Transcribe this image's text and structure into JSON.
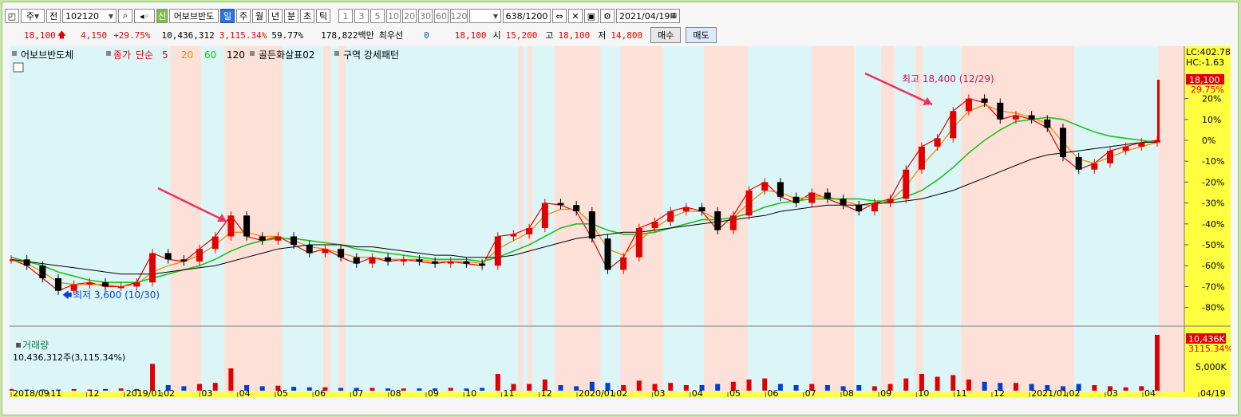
{
  "toolbar": {
    "market": "주",
    "period_short": "전",
    "stock_code": "102120",
    "badge_new": "신",
    "stock_name": "어보브반도",
    "period_tabs": [
      "일",
      "주",
      "월",
      "년",
      "분",
      "초",
      "틱"
    ],
    "active_period": "일",
    "minute_intervals": [
      "1",
      "3",
      "5",
      "10",
      "20",
      "30",
      "60",
      "120"
    ],
    "count_display": "638/1200",
    "date": "2021/04/19"
  },
  "quote": {
    "price": "18,100",
    "change": "4,150",
    "change_pct": "+29.75%",
    "volume": "10,436,312",
    "volume_ratio": "3,115.34%",
    "turnover": "59.77%",
    "value": "178,822백만",
    "priority_label": "최우선",
    "priority_bid": "0",
    "priority_ask": "18,100",
    "open_label": "시",
    "open": "15,200",
    "high_label": "고",
    "high": "18,100",
    "low_label": "저",
    "low": "14,800",
    "buy_label": "매수",
    "sell_label": "매도"
  },
  "legend": {
    "name": "어보브반도체",
    "close": "종가",
    "ma_type": "단순",
    "ma5": "5",
    "ma20": "20",
    "ma60": "60",
    "ma120": "120",
    "golden": "골든화살표02",
    "zone": "구역 강세패턴"
  },
  "labels": {
    "lc": "LC:402.78",
    "hc": "HC:-1.63",
    "last_price": "18,100",
    "last_pct": "29.75%",
    "high_note": "최고 18,400 (12/29)",
    "low_note": "최저 3,600 (10/30)",
    "vol_title": "거래량",
    "vol_value": "10,436,312주(3,115.34%)",
    "vol_last": "10,436K",
    "vol_pct": "3115.34%",
    "vol_tick": "5,000K"
  },
  "colors": {
    "up": "#e00000",
    "down": "#0040d0",
    "ma5": "#e00000",
    "ma20": "#f08a00",
    "ma60": "#20c020",
    "ma120": "#000000",
    "zone_red": "#fde0d8",
    "zone_cyan": "#dcf6f8",
    "arrow": "#f03060",
    "axis_bg": "#ffff40"
  },
  "chart_data": {
    "type": "line",
    "title": "어보브반도체",
    "y_ticks": [
      "20%",
      "10%",
      "0%",
      "-10%",
      "-20%",
      "-30%",
      "-40%",
      "-50%",
      "-60%",
      "-70%",
      "-80%"
    ],
    "x_ticks": [
      "2018/09",
      "11",
      "12",
      "2019/01",
      "02",
      "03",
      "04",
      "05",
      "06",
      "07",
      "08",
      "09",
      "10",
      "11",
      "12",
      "2020/01",
      "02",
      "03",
      "04",
      "05",
      "06",
      "07",
      "08",
      "09",
      "10",
      "11",
      "12",
      "2021/01",
      "02",
      "03",
      "04",
      "04/19"
    ],
    "series": [
      {
        "name": "종가",
        "values": [
          -57,
          -60,
          -66,
          -72,
          -69,
          -68,
          -70,
          -70,
          -68,
          -54,
          -57,
          -58,
          -52,
          -46,
          -36,
          -46,
          -48,
          -46,
          -50,
          -54,
          -52,
          -56,
          -59,
          -56,
          -58,
          -57,
          -58,
          -59,
          -58,
          -59,
          -60,
          -46,
          -45,
          -42,
          -30,
          -31,
          -34,
          -47,
          -62,
          -56,
          -42,
          -39,
          -34,
          -32,
          -34,
          -43,
          -36,
          -24,
          -20,
          -27,
          -30,
          -25,
          -28,
          -31,
          -34,
          -30,
          -28,
          -14,
          -3,
          1,
          14,
          20,
          18,
          10,
          12,
          10,
          6,
          -8,
          -14,
          -11,
          -5,
          -3,
          -1,
          0
        ]
      },
      {
        "name": "5",
        "values": [
          -57,
          -60,
          -66,
          -72,
          -69,
          -68,
          -70,
          -70,
          -68,
          -54,
          -57,
          -58,
          -52,
          -46,
          -36,
          -46,
          -48,
          -46,
          -50,
          -54,
          -52,
          -56,
          -59,
          -56,
          -58,
          -57,
          -58,
          -59,
          -58,
          -59,
          -60,
          -46,
          -45,
          -42,
          -30,
          -31,
          -34,
          -47,
          -62,
          -56,
          -42,
          -39,
          -34,
          -32,
          -34,
          -43,
          -36,
          -24,
          -20,
          -27,
          -30,
          -25,
          -28,
          -31,
          -34,
          -30,
          -28,
          -14,
          -3,
          1,
          14,
          20,
          18,
          10,
          12,
          10,
          6,
          -8,
          -14,
          -11,
          -5,
          -3,
          -1,
          0
        ]
      },
      {
        "name": "20",
        "values": [
          -57,
          -59,
          -63,
          -68,
          -69,
          -69,
          -69,
          -70,
          -69,
          -63,
          -60,
          -58,
          -55,
          -50,
          -44,
          -44,
          -46,
          -46,
          -48,
          -51,
          -52,
          -54,
          -56,
          -56,
          -57,
          -57,
          -57,
          -58,
          -58,
          -58,
          -59,
          -52,
          -48,
          -44,
          -36,
          -33,
          -33,
          -40,
          -52,
          -55,
          -48,
          -42,
          -37,
          -34,
          -34,
          -38,
          -37,
          -30,
          -24,
          -25,
          -28,
          -27,
          -27,
          -29,
          -31,
          -31,
          -29,
          -22,
          -12,
          -4,
          6,
          14,
          17,
          14,
          13,
          11,
          8,
          -1,
          -9,
          -11,
          -8,
          -5,
          -3,
          -1
        ]
      },
      {
        "name": "60",
        "values": [
          -56,
          -58,
          -60,
          -63,
          -65,
          -67,
          -68,
          -68,
          -68,
          -66,
          -64,
          -62,
          -60,
          -57,
          -53,
          -50,
          -48,
          -47,
          -47,
          -48,
          -49,
          -50,
          -52,
          -53,
          -54,
          -55,
          -56,
          -57,
          -57,
          -57,
          -58,
          -56,
          -53,
          -50,
          -46,
          -42,
          -40,
          -40,
          -43,
          -45,
          -45,
          -44,
          -42,
          -40,
          -38,
          -38,
          -37,
          -35,
          -32,
          -30,
          -29,
          -28,
          -28,
          -28,
          -28,
          -29,
          -29,
          -27,
          -24,
          -19,
          -13,
          -6,
          0,
          5,
          9,
          10,
          11,
          10,
          7,
          4,
          2,
          1,
          0,
          -1
        ]
      },
      {
        "name": "120",
        "values": [
          -57,
          -58,
          -59,
          -60,
          -61,
          -62,
          -63,
          -64,
          -64,
          -64,
          -63,
          -62,
          -61,
          -60,
          -58,
          -56,
          -54,
          -52,
          -51,
          -50,
          -50,
          -50,
          -51,
          -51,
          -52,
          -53,
          -54,
          -55,
          -55,
          -56,
          -56,
          -56,
          -55,
          -53,
          -51,
          -49,
          -47,
          -46,
          -45,
          -44,
          -44,
          -43,
          -42,
          -41,
          -40,
          -39,
          -38,
          -37,
          -36,
          -34,
          -33,
          -32,
          -31,
          -31,
          -31,
          -30,
          -30,
          -29,
          -28,
          -26,
          -24,
          -21,
          -18,
          -15,
          -12,
          -9,
          -7,
          -6,
          -5,
          -4,
          -3,
          -2,
          -1,
          -1
        ]
      }
    ],
    "volume_pct": [
      3,
      2,
      2,
      2,
      3,
      2,
      3,
      4,
      3,
      48,
      10,
      8,
      12,
      14,
      40,
      10,
      8,
      9,
      7,
      6,
      6,
      5,
      5,
      5,
      4,
      4,
      4,
      4,
      5,
      4,
      5,
      30,
      12,
      12,
      20,
      10,
      8,
      16,
      14,
      10,
      18,
      12,
      14,
      10,
      10,
      12,
      16,
      20,
      22,
      12,
      10,
      12,
      10,
      8,
      10,
      8,
      12,
      22,
      30,
      25,
      28,
      20,
      16,
      14,
      14,
      12,
      10,
      8,
      12,
      10,
      8,
      6,
      8,
      100
    ],
    "zones": [
      {
        "type": "red",
        "from": 0.137,
        "to": 0.163
      },
      {
        "type": "red",
        "from": 0.183,
        "to": 0.232
      },
      {
        "type": "red",
        "from": 0.267,
        "to": 0.273
      },
      {
        "type": "red",
        "from": 0.28,
        "to": 0.286
      },
      {
        "type": "red",
        "from": 0.433,
        "to": 0.437
      },
      {
        "type": "red",
        "from": 0.441,
        "to": 0.445
      },
      {
        "type": "red",
        "from": 0.464,
        "to": 0.503
      },
      {
        "type": "red",
        "from": 0.52,
        "to": 0.556
      },
      {
        "type": "red",
        "from": 0.591,
        "to": 0.628
      },
      {
        "type": "red",
        "from": 0.683,
        "to": 0.719
      },
      {
        "type": "red",
        "from": 0.742,
        "to": 0.753
      },
      {
        "type": "red",
        "from": 0.771,
        "to": 0.777
      },
      {
        "type": "red",
        "from": 0.81,
        "to": 0.906
      },
      {
        "type": "red",
        "from": 0.978,
        "to": 1.0
      }
    ]
  }
}
